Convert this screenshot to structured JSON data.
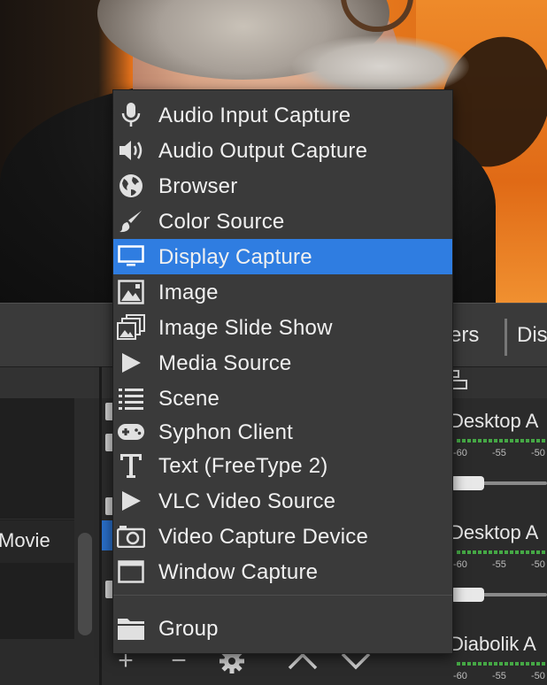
{
  "preview": {
    "description_hidden": true
  },
  "docks": {
    "mixer_tab_partial": "ers",
    "next_tab_partial": "Dis",
    "scenes": {
      "visible_item": "Movie"
    },
    "mixer": {
      "tracks": [
        {
          "name": "Desktop A",
          "ticks": [
            "-60",
            "-55",
            "-50"
          ],
          "level": 0.18
        },
        {
          "name": "Desktop A",
          "ticks": [
            "-60",
            "-55",
            "-50"
          ],
          "level": 0.18
        },
        {
          "name": "Diabolik A",
          "ticks": [
            "-60",
            "-55",
            "-50"
          ]
        }
      ]
    },
    "sources_toolbar": {
      "add": "+",
      "remove": "−",
      "up": "∧",
      "down": "∨"
    }
  },
  "add_source_menu": {
    "items": [
      {
        "label": "Audio Input Capture",
        "icon": "microphone-icon"
      },
      {
        "label": "Audio Output Capture",
        "icon": "speaker-icon"
      },
      {
        "label": "Browser",
        "icon": "globe-icon"
      },
      {
        "label": "Color Source",
        "icon": "paintbrush-icon"
      },
      {
        "label": "Display Capture",
        "icon": "monitor-icon",
        "selected": true
      },
      {
        "label": "Image",
        "icon": "image-icon"
      },
      {
        "label": "Image Slide Show",
        "icon": "slideshow-icon"
      },
      {
        "label": "Media Source",
        "icon": "play-icon"
      },
      {
        "label": "Scene",
        "icon": "list-icon"
      },
      {
        "label": "Syphon Client",
        "icon": "gamepad-icon"
      },
      {
        "label": "Text (FreeType 2)",
        "icon": "text-icon"
      },
      {
        "label": "VLC Video Source",
        "icon": "play-icon"
      },
      {
        "label": "Video Capture Device",
        "icon": "camera-icon"
      },
      {
        "label": "Window Capture",
        "icon": "window-icon"
      }
    ],
    "group": {
      "label": "Group",
      "icon": "folder-icon"
    }
  },
  "colors": {
    "accent": "#2f7de1",
    "menu_bg": "#3a3a3a",
    "meter_green": "#45a845"
  }
}
